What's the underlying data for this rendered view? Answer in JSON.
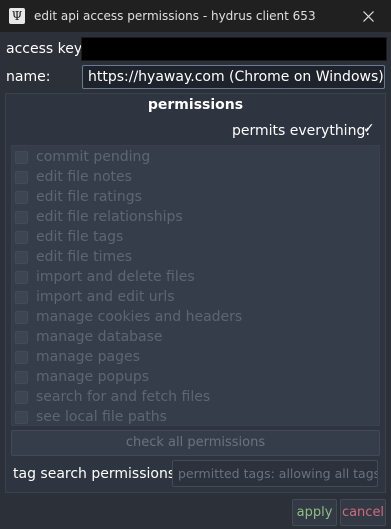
{
  "window": {
    "title": "edit api access permissions - hydrus client 653",
    "app_icon": "psi-icon",
    "app_icon_glyph": "Ψ",
    "close_icon": "close-icon"
  },
  "access_key": {
    "label": "access key:",
    "value": ""
  },
  "name": {
    "label": "name:",
    "value": "https://hyaway.com (Chrome on Windows)"
  },
  "permissions": {
    "title": "permissions",
    "permits_everything_label": "permits everything:",
    "permits_everything_checked": true,
    "permits_everything_mark": "✓",
    "items": [
      {
        "label": "commit pending",
        "checked": false
      },
      {
        "label": "edit file notes",
        "checked": false
      },
      {
        "label": "edit file ratings",
        "checked": false
      },
      {
        "label": "edit file relationships",
        "checked": false
      },
      {
        "label": "edit file tags",
        "checked": false
      },
      {
        "label": "edit file times",
        "checked": false
      },
      {
        "label": "import and delete files",
        "checked": false
      },
      {
        "label": "import and edit urls",
        "checked": false
      },
      {
        "label": "manage cookies and headers",
        "checked": false
      },
      {
        "label": "manage database",
        "checked": false
      },
      {
        "label": "manage pages",
        "checked": false
      },
      {
        "label": "manage popups",
        "checked": false
      },
      {
        "label": "search for and fetch files",
        "checked": false
      },
      {
        "label": "see local file paths",
        "checked": false
      }
    ],
    "check_all_label": "check all permissions"
  },
  "tag_search": {
    "label": "tag search permissions:",
    "value": "permitted tags: allowing all tags"
  },
  "buttons": {
    "apply": "apply",
    "cancel": "cancel"
  },
  "colors": {
    "apply_text": "#8fbf7f",
    "cancel_text": "#d06b78"
  }
}
